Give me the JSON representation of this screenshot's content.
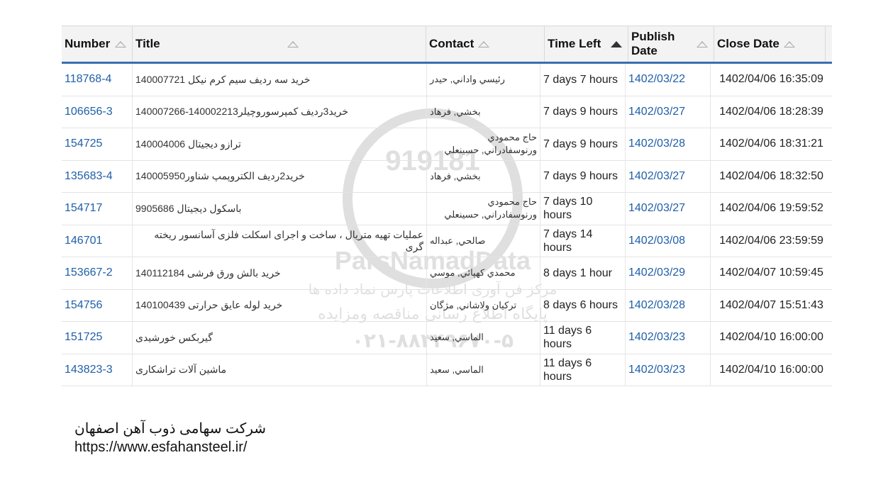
{
  "columns": {
    "number": "Number",
    "title": "Title",
    "contact": "Contact",
    "time_left": "Time Left",
    "publish_date": "Publish Date",
    "close_date": "Close Date"
  },
  "rows": [
    {
      "number": "118768-4",
      "title": "خرید سه ردیف سیم کرم نیکل 140007721",
      "contact": "رئيسي واداني, حيدر",
      "time_left": "7 days 7 hours",
      "publish": "1402/03/22",
      "close": "1402/04/06 16:35:09"
    },
    {
      "number": "106656-3",
      "title": "خرید3ردیف کمپرسوروچیلر140002213-140007266",
      "contact": "بخشي, فرهاد",
      "time_left": "7 days 9 hours",
      "publish": "1402/03/27",
      "close": "1402/04/06 18:28:39"
    },
    {
      "number": "154725",
      "title": "ترازو دیجیتال 140004006",
      "contact": "حاج محمودي ورنوسفادراني, حسينعلي",
      "time_left": "7 days 9 hours",
      "publish": "1402/03/28",
      "close": "1402/04/06 18:31:21"
    },
    {
      "number": "135683-4",
      "title": "خرید2ردیف الکتروپمپ شناور140005950",
      "contact": "بخشي, فرهاد",
      "time_left": "7 days 9 hours",
      "publish": "1402/03/27",
      "close": "1402/04/06 18:32:50"
    },
    {
      "number": "154717",
      "title": "باسکول دیجیتال 9905686",
      "contact": "حاج محمودي ورنوسفادراني, حسينعلي",
      "time_left": "7 days 10 hours",
      "publish": "1402/03/27",
      "close": "1402/04/06 19:59:52"
    },
    {
      "number": "146701",
      "title": "عملیات تهیه متریال ، ساخت و اجرای اسکلت فلزی آسانسور ریخته گری",
      "contact": "صالحي, عبداله",
      "time_left": "7 days 14 hours",
      "publish": "1402/03/08",
      "close": "1402/04/06 23:59:59"
    },
    {
      "number": "153667-2",
      "title": "خرید بالش ورق فرشی 140112184",
      "contact": "محمدي کهپائي, موسي",
      "time_left": "8 days 1 hour",
      "publish": "1402/03/29",
      "close": "1402/04/07 10:59:45"
    },
    {
      "number": "154756",
      "title": "خرید لوله عایق حرارتی 140100439",
      "contact": "ترکيان ولاشاني, مژگان",
      "time_left": "8 days 6 hours",
      "publish": "1402/03/28",
      "close": "1402/04/07 15:51:43"
    },
    {
      "number": "151725",
      "title": "گیربکس خورشیدی",
      "contact": "الماسي, سعيد",
      "time_left": "11 days 6 hours",
      "publish": "1402/03/23",
      "close": "1402/04/10 16:00:00"
    },
    {
      "number": "143823-3",
      "title": "ماشین آلات تراشکاری",
      "contact": "الماسي, سعيد",
      "time_left": "11 days 6 hours",
      "publish": "1402/03/23",
      "close": "1402/04/10 16:00:00"
    }
  ],
  "watermark": {
    "brand": "ParsNamadData",
    "subtitle": "مرکز فن آوری اطلاعات پارس نماد داده ها",
    "tagline": "پایگاه اطلاع رسانی مناقصه ومزایده",
    "phone": "۰۲۱-۸۸۳۴۹۶۷۰-۵",
    "code": "919181"
  },
  "footer": {
    "company": "شرکت سهامی ذوب آهن اصفهان",
    "url": "https://www.esfahansteel.ir/"
  },
  "colors": {
    "link": "#1f5fa8",
    "header_border": "#3a6fb0",
    "header_bg": "#f3f3f3"
  },
  "sort": {
    "column": "time_left",
    "direction": "ascending"
  }
}
